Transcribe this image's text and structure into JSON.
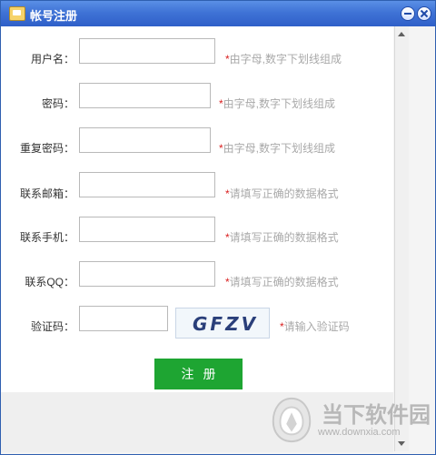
{
  "window": {
    "title": "帐号注册"
  },
  "form": {
    "username": {
      "label": "用户名：",
      "value": "",
      "hint": "由字母,数字下划线组成"
    },
    "password": {
      "label": "密码：",
      "value": "",
      "hint": "由字母,数字下划线组成"
    },
    "confirm_password": {
      "label": "重复密码：",
      "value": "",
      "hint": "由字母,数字下划线组成"
    },
    "email": {
      "label": "联系邮箱：",
      "value": "",
      "hint": "请填写正确的数据格式"
    },
    "phone": {
      "label": "联系手机：",
      "value": "",
      "hint": "请填写正确的数据格式"
    },
    "qq": {
      "label": "联系QQ：",
      "value": "",
      "hint": "请填写正确的数据格式"
    },
    "captcha": {
      "label": "验证码：",
      "value": "",
      "image_text": "GFZV",
      "hint": "请输入验证码"
    },
    "required_mark": "*",
    "submit_label": "注册"
  },
  "watermark": {
    "name": "当下软件园",
    "url": "www.downxia.com"
  },
  "colors": {
    "titlebar": "#3f73d6",
    "accent_green": "#1ea532",
    "required_red": "#d92020",
    "hint_gray": "#a9a9a9"
  },
  "icons": {
    "app": "app-icon",
    "minimize": "minimize-icon",
    "close": "close-icon",
    "scroll_up": "scroll-up-arrow-icon",
    "scroll_down": "scroll-down-arrow-icon"
  }
}
